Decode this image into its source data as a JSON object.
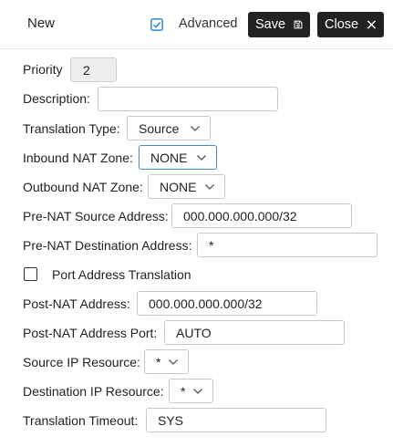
{
  "header": {
    "title": "New",
    "advanced_label": "Advanced",
    "advanced_checked": true,
    "save_label": "Save",
    "close_label": "Close"
  },
  "form": {
    "priority": {
      "label": "Priority",
      "value": "2"
    },
    "description": {
      "label": "Description:",
      "value": ""
    },
    "translation_type": {
      "label": "Translation Type:",
      "value": "Source"
    },
    "inbound_nat_zone": {
      "label": "Inbound NAT Zone:",
      "value": "NONE"
    },
    "outbound_nat_zone": {
      "label": "Outbound NAT Zone:",
      "value": "NONE"
    },
    "pre_nat_source": {
      "label": "Pre-NAT Source Address:",
      "value": "000.000.000.000/32"
    },
    "pre_nat_destination": {
      "label": "Pre-NAT Destination Address:",
      "value": "*"
    },
    "port_address_translation": {
      "label": "Port Address Translation",
      "checked": false
    },
    "post_nat_address": {
      "label": "Post-NAT Address:",
      "value": "000.000.000.000/32"
    },
    "post_nat_address_port": {
      "label": "Post-NAT Address Port:",
      "value": "AUTO"
    },
    "source_ip_resource": {
      "label": "Source IP Resource:",
      "value": "*"
    },
    "destination_ip_resource": {
      "label": "Destination IP Resource:",
      "value": "*"
    },
    "translation_timeout": {
      "label": "Translation Timeout:",
      "value": "SYS"
    }
  },
  "colors": {
    "button_bg": "#222222",
    "focus_border": "#3c8dd6",
    "check_accent": "#3c8dd6",
    "disabled_bg": "#eeeeee"
  }
}
